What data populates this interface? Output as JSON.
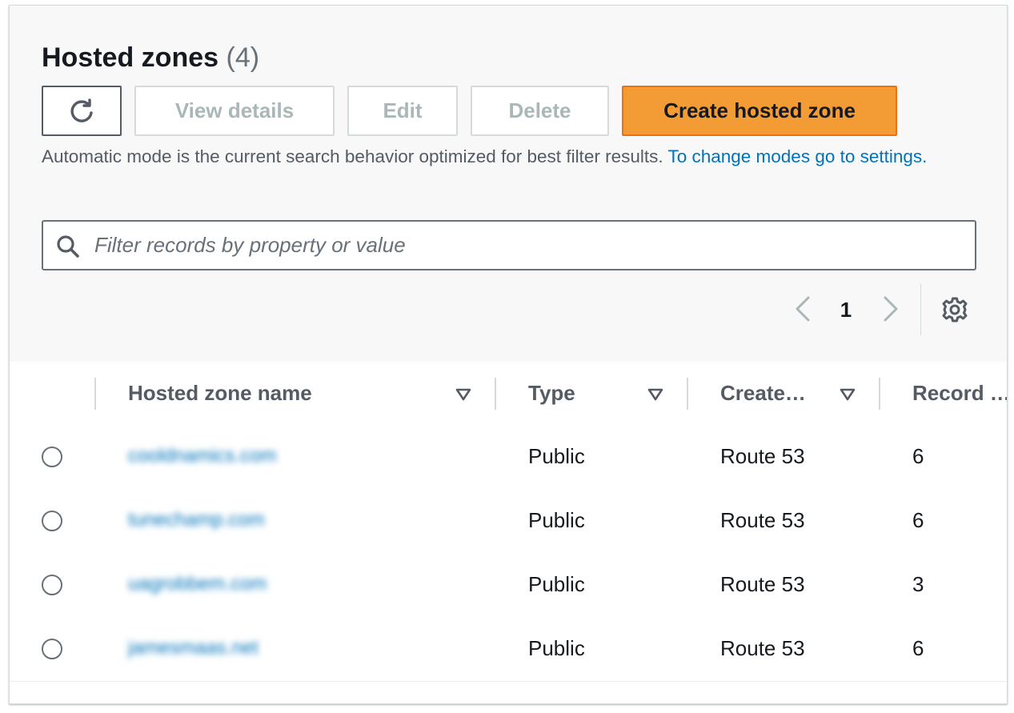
{
  "header": {
    "title": "Hosted zones",
    "count": "(4)"
  },
  "toolbar": {
    "refresh_icon": "refresh-icon",
    "view_details_label": "View details",
    "edit_label": "Edit",
    "delete_label": "Delete",
    "create_label": "Create hosted zone"
  },
  "info": {
    "text": "Automatic mode is the current search behavior optimized for best filter results.",
    "link": "To change modes go to settings."
  },
  "search": {
    "placeholder": "Filter records by property or value",
    "icon": "search-icon"
  },
  "pagination": {
    "current_page": "1",
    "prev_icon": "chevron-left-icon",
    "next_icon": "chevron-right-icon",
    "settings_icon": "gear-icon"
  },
  "table": {
    "columns": [
      "Hosted zone name",
      "Type",
      "Create…",
      "Record …"
    ],
    "rows": [
      {
        "name": "cooldnamics.com",
        "type": "Public",
        "created_by": "Route 53",
        "records": "6"
      },
      {
        "name": "tunechamp.com",
        "type": "Public",
        "created_by": "Route 53",
        "records": "6"
      },
      {
        "name": "uagrobbem.com",
        "type": "Public",
        "created_by": "Route 53",
        "records": "3"
      },
      {
        "name": "jamesmaas.net",
        "type": "Public",
        "created_by": "Route 53",
        "records": "6"
      }
    ]
  },
  "colors": {
    "primary_button": "#f39c36",
    "link": "#0073bb",
    "disabled_text": "#aab7b8"
  }
}
